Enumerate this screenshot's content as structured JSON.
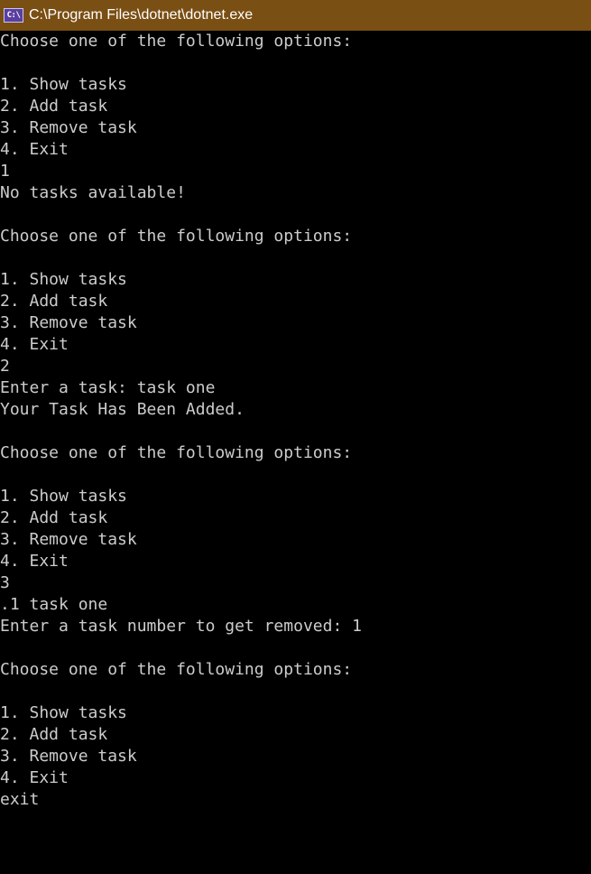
{
  "window": {
    "title": "C:\\Program Files\\dotnet\\dotnet.exe",
    "icon": "console-icon",
    "icon_glyph": "C:\\",
    "titlebar_color": "#7a4f14"
  },
  "console": {
    "text_color": "#cccccc",
    "background": "#000000",
    "lines": [
      "Choose one of the following options:",
      "",
      "1. Show tasks",
      "2. Add task",
      "3. Remove task",
      "4. Exit",
      "1",
      "No tasks available!",
      "",
      "Choose one of the following options:",
      "",
      "1. Show tasks",
      "2. Add task",
      "3. Remove task",
      "4. Exit",
      "2",
      "Enter a task: task one",
      "Your Task Has Been Added.",
      "",
      "Choose one of the following options:",
      "",
      "1. Show tasks",
      "2. Add task",
      "3. Remove task",
      "4. Exit",
      "3",
      ".1 task one",
      "Enter a task number to get removed: 1",
      "",
      "Choose one of the following options:",
      "",
      "1. Show tasks",
      "2. Add task",
      "3. Remove task",
      "4. Exit",
      "exit"
    ]
  }
}
